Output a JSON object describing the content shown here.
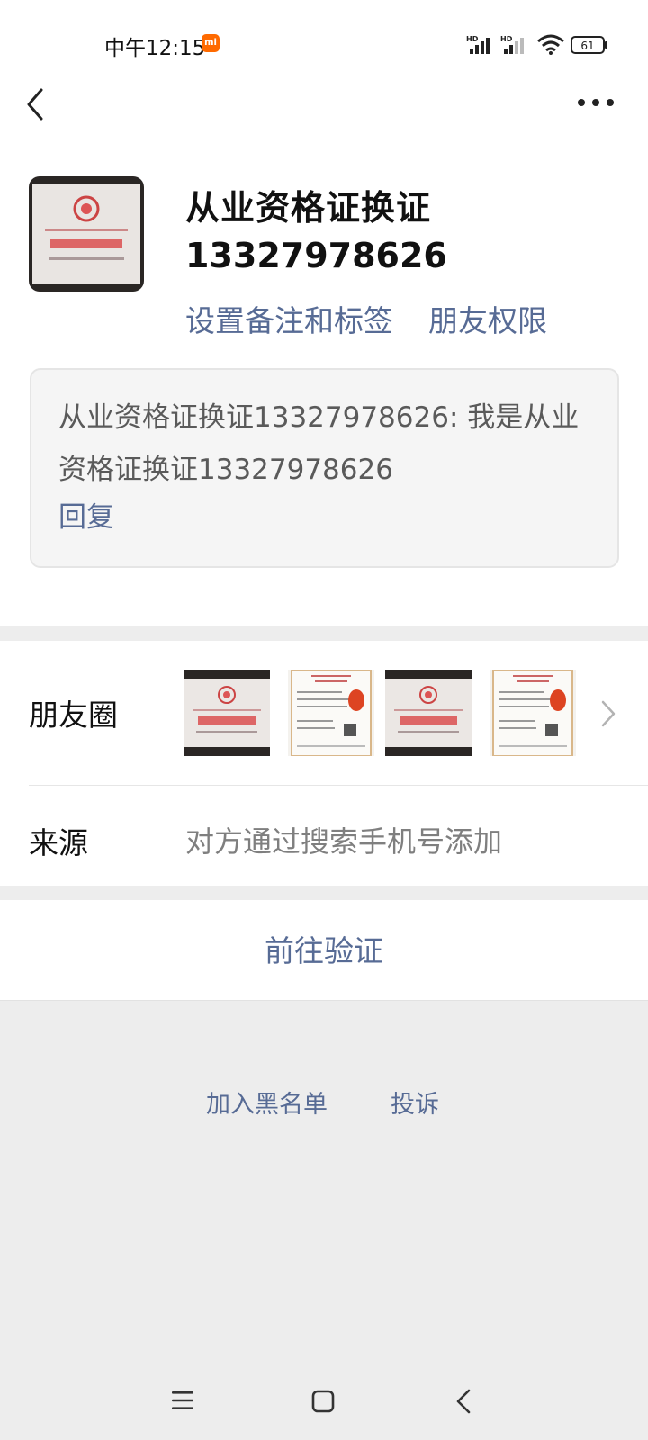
{
  "status_bar": {
    "time": "中午12:15",
    "mi_badge": "mi",
    "signal1_label": "HD",
    "signal2_label": "HD",
    "battery": "61"
  },
  "nav": {
    "back_icon": "chevron-left-icon",
    "more_icon": "more-dots-icon"
  },
  "profile": {
    "name": "从业资格证换证",
    "wechat_id": "13327978626",
    "remark_link": "设置备注和标签",
    "permission_link": "朋友权限"
  },
  "greeting": {
    "text": "从业资格证换证13327978626: 我是从业资格证换证13327978626",
    "reply": "回复"
  },
  "moments": {
    "label": "朋友圈",
    "thumbnail_count": 4
  },
  "source": {
    "label": "来源",
    "value": "对方通过搜索手机号添加"
  },
  "actions": {
    "verify": "前往验证",
    "blacklist": "加入黑名单",
    "complain": "投诉"
  },
  "colors": {
    "link": "#576b95",
    "background": "#ededed",
    "mi_badge": "#ff6a00"
  }
}
